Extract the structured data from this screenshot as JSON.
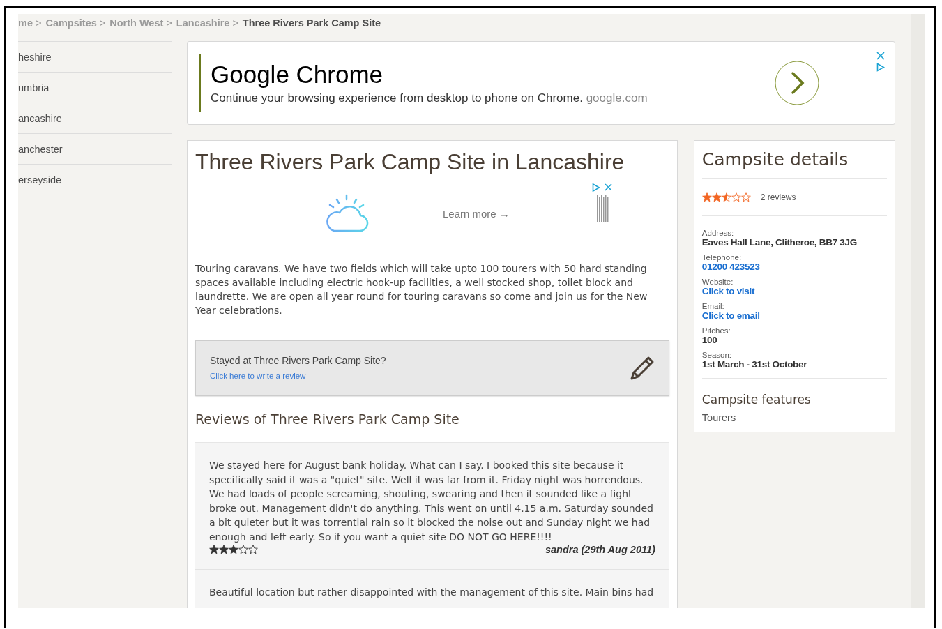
{
  "breadcrumb": [
    {
      "label": "me",
      "separator": ">",
      "current": false
    },
    {
      "label": "Campsites",
      "separator": ">",
      "current": false
    },
    {
      "label": "North West",
      "separator": ">",
      "current": false
    },
    {
      "label": "Lancashire",
      "separator": ">",
      "current": false
    },
    {
      "label": "Three Rivers Park Camp Site",
      "current": true
    }
  ],
  "sidebar": {
    "items": [
      "heshire",
      "umbria",
      "ancashire",
      "anchester",
      "erseyside"
    ]
  },
  "top_ad": {
    "title": "Google Chrome",
    "text": "Continue your browsing experience from desktop to phone on Chrome.",
    "domain": "google.com"
  },
  "main": {
    "title": "Three Rivers Park Camp Site in Lancashire",
    "inline_ad": {
      "link": "Learn more →"
    },
    "description": "Touring caravans. We have two fields which will take upto 100 tourers with 50 hard standing spaces available including electric hook-up facilities, a well stocked shop, toilet block and laundrette. We are open all year round for touring caravans so come and join us for the New Year celebrations.",
    "review_prompt": {
      "question": "Stayed at Three Rivers Park Camp Site?",
      "link": "Click here to write a review"
    },
    "reviews_title": "Reviews of Three Rivers Park Camp Site",
    "reviews": [
      {
        "text": "We stayed here for August bank holiday. What can I say. I booked this site because it specifically said it was a \"quiet\" site. Well it was far from it. Friday night was horrendous. We had loads of people screaming, shouting, swearing and then it sounded like a fight broke out. Management didn't do anything. This went on until 4.15 a.m. Saturday sounded a bit quieter but it was torrential rain so it blocked the noise out and Sunday night we had enough and left early. So if you want a quiet site DO NOT GO HERE!!!!",
        "stars": 3,
        "author": "sandra (29th Aug 2011)"
      },
      {
        "text": "Beautiful location but rather disappointed with the management of this site. Main bins had"
      }
    ]
  },
  "details": {
    "title": "Campsite details",
    "stars": 2.5,
    "review_count": "2 reviews",
    "fields": [
      {
        "label": "Address:",
        "value": "Eaves Hall Lane, Clitheroe, BB7 3JG",
        "kind": "text"
      },
      {
        "label": "Telephone:",
        "value": "01200 423523",
        "kind": "phone"
      },
      {
        "label": "Website:",
        "value": "Click to visit",
        "kind": "link"
      },
      {
        "label": "Email:",
        "value": "Click to email",
        "kind": "link"
      },
      {
        "label": "Pitches:",
        "value": "100",
        "kind": "text"
      },
      {
        "label": "Season:",
        "value": "1st March - 31st October",
        "kind": "text"
      }
    ],
    "features_title": "Campsite features",
    "features": [
      "Tourers"
    ]
  }
}
